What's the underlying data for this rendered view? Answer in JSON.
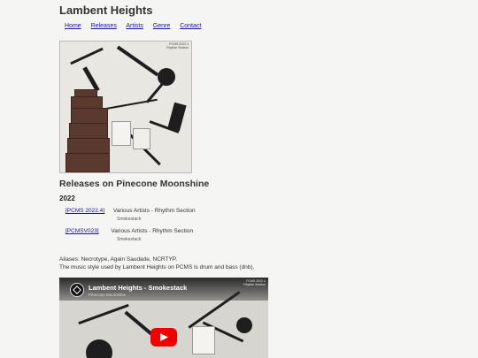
{
  "site": {
    "title": "Lambent Heights"
  },
  "nav": [
    {
      "label": "Home"
    },
    {
      "label": "Releases"
    },
    {
      "label": "Artists"
    },
    {
      "label": "Genre"
    },
    {
      "label": "Contact"
    }
  ],
  "cover": {
    "label_line1": "PCMS 2022.4",
    "label_line2": "Rhythm Section"
  },
  "releases": {
    "heading": "Releases on Pinecone Moonshine",
    "year": "2022",
    "items": [
      {
        "cat": "[PCMS 2022.4]",
        "title": "Various Artists - Rhythm Section",
        "track": "Smokestack"
      },
      {
        "cat": "[PCMSV023]",
        "title": "Various Artists - Rhythm Section",
        "track": "Smokestack"
      }
    ]
  },
  "info": {
    "aliases": "Aliases: Necrotype, Again Saudade, NCRTYP.",
    "style": "The music style used by Lambent Heights on PCMS is drum and bass (dnb)."
  },
  "video": {
    "title": "Lambent Heights - Smokestack",
    "subtitle": "Pinecone Moonshine",
    "corner1": "PCMS 2022.4",
    "corner2": "Rhythm Section"
  }
}
